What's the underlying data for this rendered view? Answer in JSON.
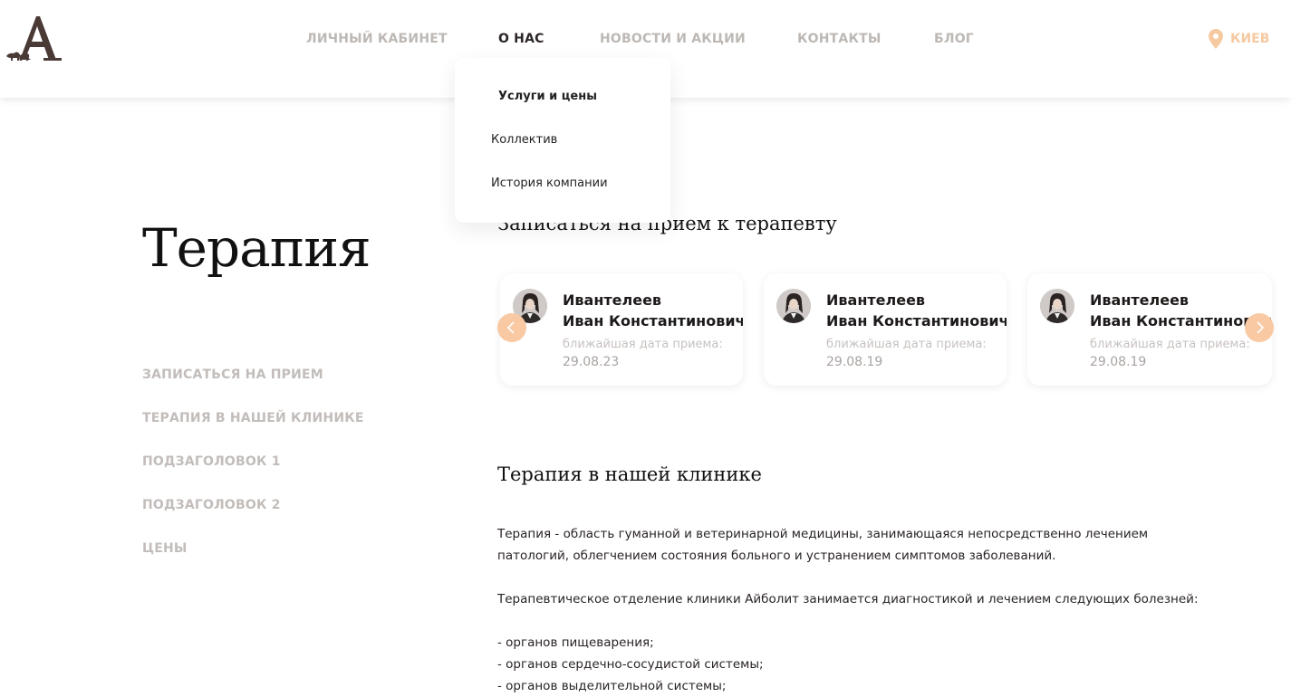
{
  "header": {
    "logo_letter": "A",
    "nav": [
      {
        "label": "ЛИЧНЫЙ КАБИНЕТ",
        "active": false
      },
      {
        "label": "О НАС",
        "active": true
      },
      {
        "label": "НОВОСТИ И АКЦИИ",
        "active": false
      },
      {
        "label": "КОНТАКТЫ",
        "active": false
      },
      {
        "label": "БЛОГ",
        "active": false
      }
    ],
    "city": {
      "label": "КИЕВ",
      "icon": "map-pin-icon"
    }
  },
  "dropdown": {
    "items": [
      {
        "label": "Услуги и цены"
      },
      {
        "label": "Коллектив"
      },
      {
        "label": "История компании"
      }
    ]
  },
  "page": {
    "title": "Терапия",
    "side_nav": [
      {
        "label": "ЗАПИСАТЬСЯ НА ПРИЕМ"
      },
      {
        "label": "ТЕРАПИЯ В НАШЕЙ КЛИНИКЕ"
      },
      {
        "label": "ПОДЗАГОЛОВОК 1"
      },
      {
        "label": "ПОДЗАГОЛОВОК 2"
      },
      {
        "label": "ЦЕНЫ"
      }
    ]
  },
  "appointment": {
    "heading": "Записаться на прием к терапевту",
    "doctors": [
      {
        "last_name": "Ивантелеев",
        "first_name": "Иван Константинович",
        "date_label": "ближайшая дата приема:",
        "date": "29.08.23"
      },
      {
        "last_name": "Ивантелеев",
        "first_name": "Иван Константинович",
        "date_label": "ближайшая дата приема:",
        "date": "29.08.19"
      },
      {
        "last_name": "Ивантелеев",
        "first_name": "Иван Константинович",
        "date_label": "ближайшая дата приема:",
        "date": "29.08.19"
      }
    ],
    "prev_icon": "chevron-left-icon",
    "next_icon": "chevron-right-icon"
  },
  "article": {
    "heading": "Терапия в нашей клинике",
    "intro_lines": [
      "Терапия - область гуманной и ветеринарной медицины, занимающаяся непосредственно лечением",
      "патологий, облегчением состояния больного и устранением симптомов заболеваний."
    ],
    "department_line": "Терапевтическое отделение клиники Айболит занимается диагностикой и лечением следующих болезней:",
    "list": [
      "- органов пищеварения;",
      "- органов сердечно-сосудистой системы;",
      "- органов выделительной системы;"
    ]
  },
  "colors": {
    "accent": "#f9c9a3",
    "nav_muted": "#bdb8b4",
    "nav_active": "#2d2626",
    "logo": "#4a3a36"
  }
}
